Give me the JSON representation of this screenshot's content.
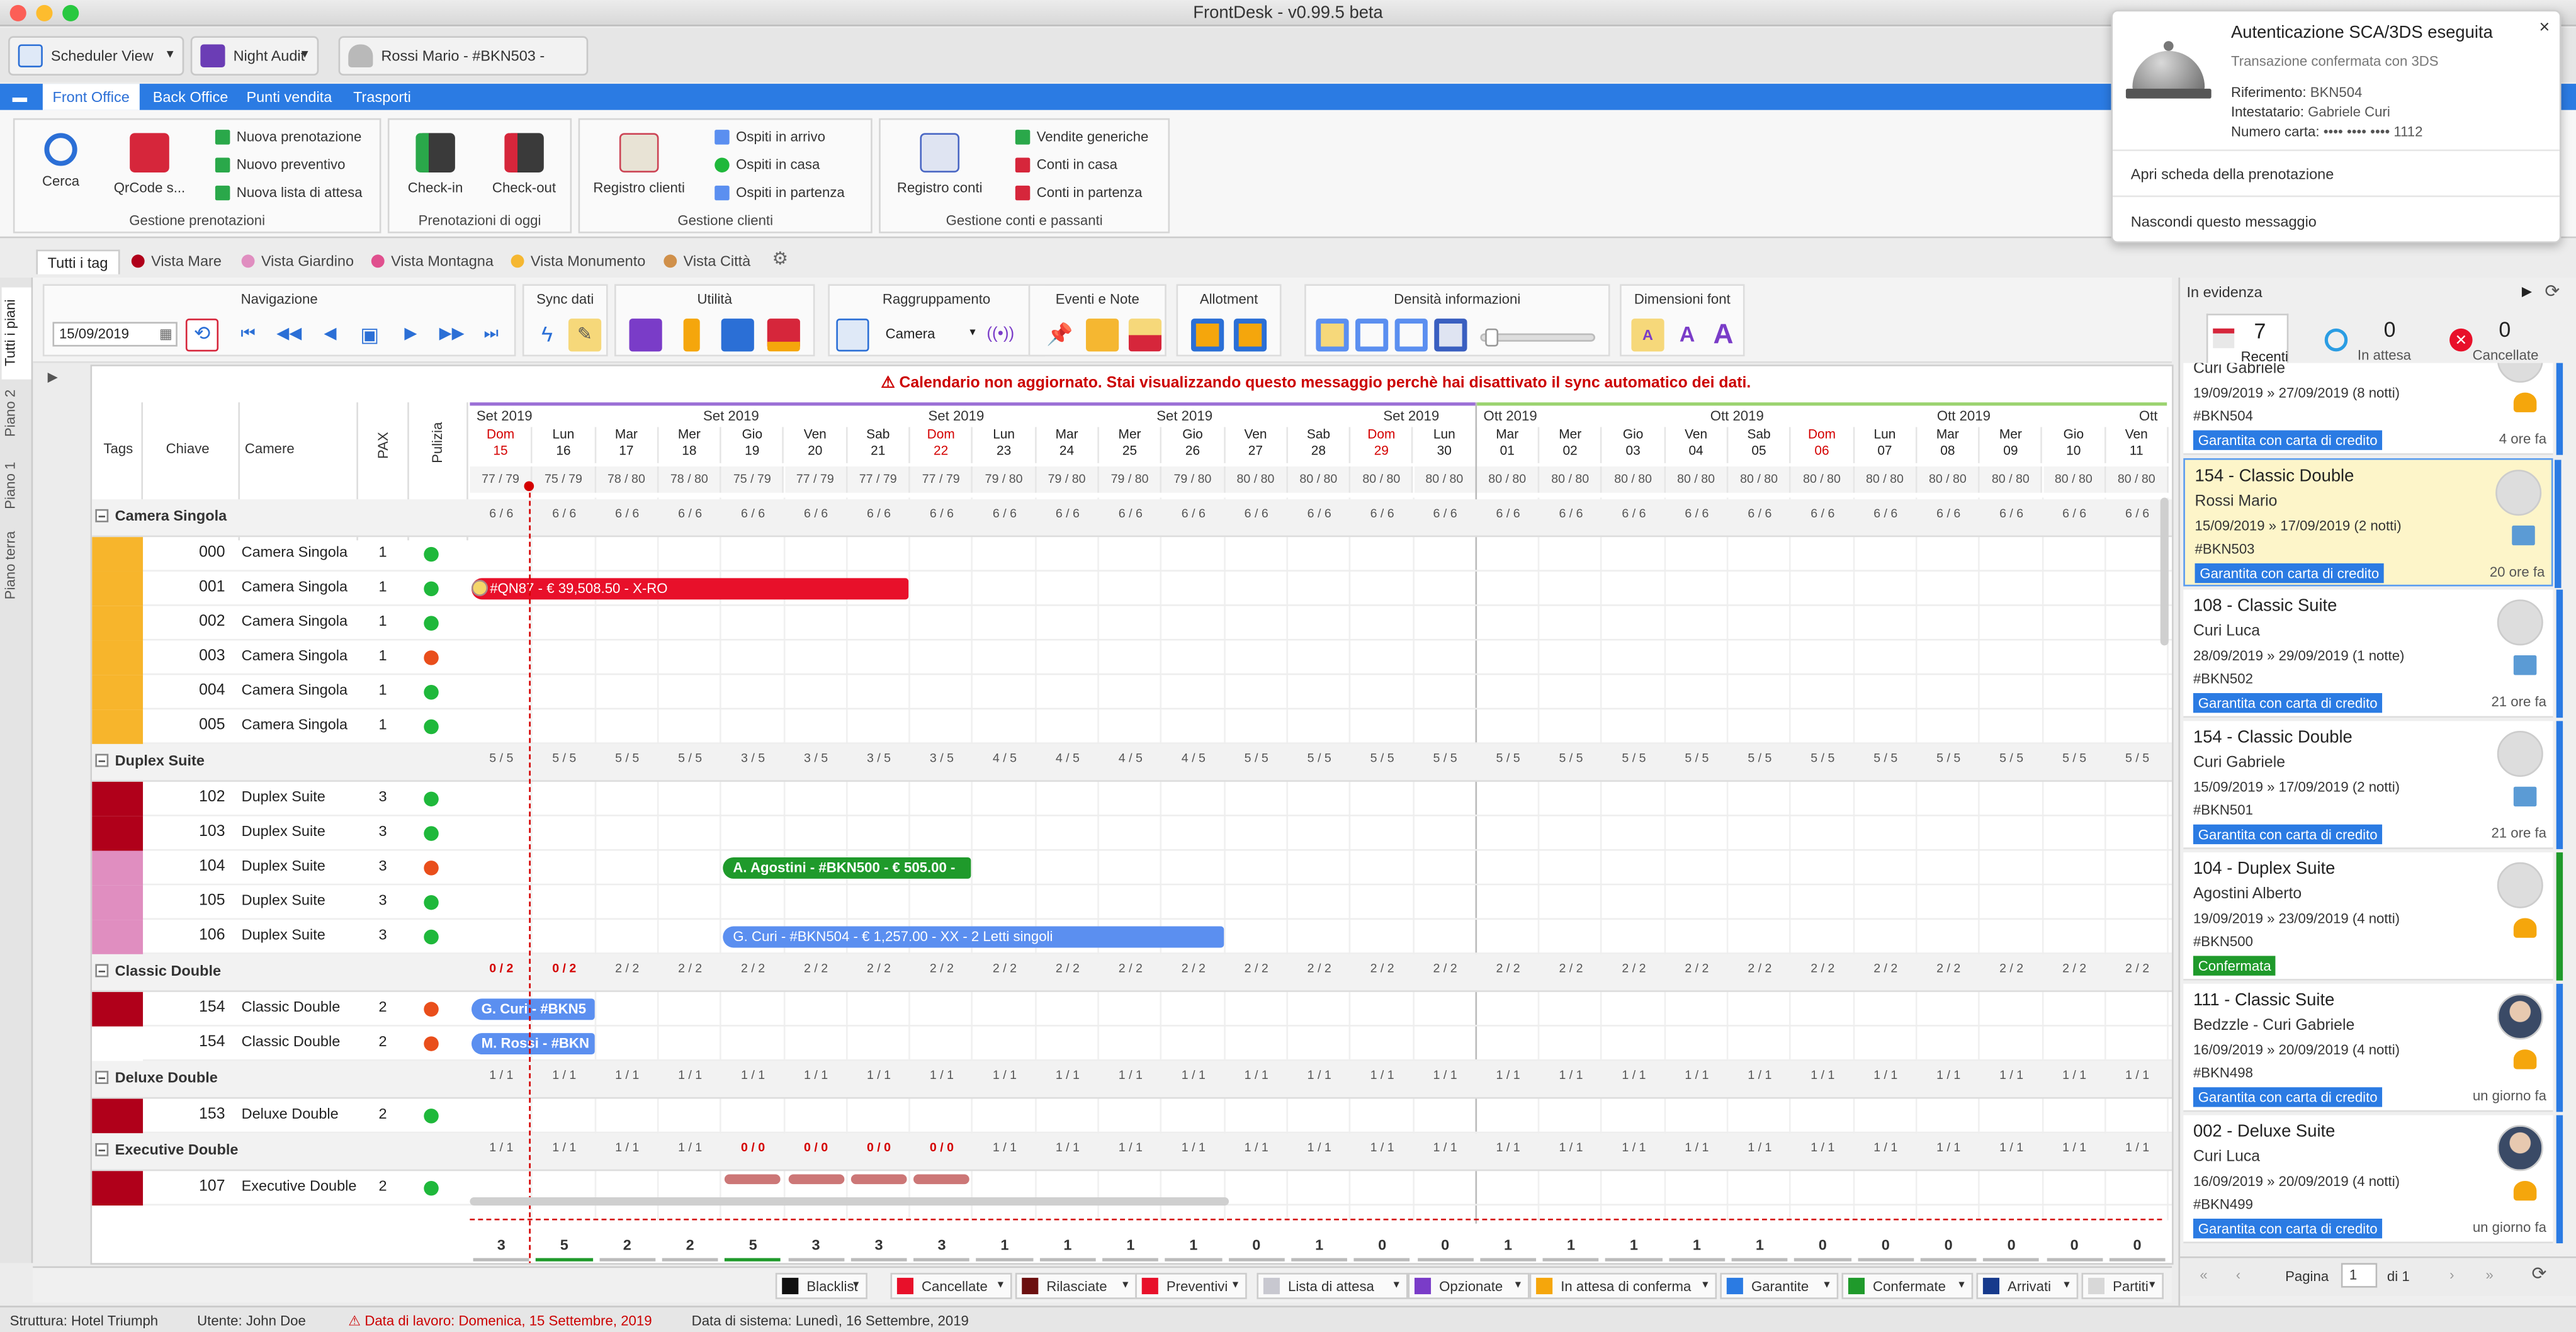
{
  "window": {
    "title": "FrontDesk - v0.99.5 beta"
  },
  "wintabs": [
    {
      "label": "Scheduler View"
    },
    {
      "label": "Night Audit"
    },
    {
      "label": "Rossi Mario - #BKN503 - Gara..."
    }
  ],
  "ribbon_tabs": [
    "Front Office",
    "Back Office",
    "Punti vendita",
    "Trasporti"
  ],
  "ribbon": {
    "gestione_prenotazioni": {
      "label": "Gestione prenotazioni",
      "cerca": "Cerca",
      "qrcode": "QrCode s...",
      "nuova_prenotazione": "Nuova prenotazione",
      "nuovo_preventivo": "Nuovo preventivo",
      "nuova_lista": "Nuova lista di attesa"
    },
    "prenotazioni_oggi": {
      "label": "Prenotazioni di oggi",
      "checkin": "Check-in",
      "checkout": "Check-out"
    },
    "gestione_clienti": {
      "label": "Gestione clienti",
      "registro": "Registro clienti",
      "arrivo": "Ospiti in arrivo",
      "casa": "Ospiti in casa",
      "partenza": "Ospiti in partenza"
    },
    "gestione_conti": {
      "label": "Gestione conti e passanti",
      "registro": "Registro conti",
      "vendite": "Vendite generiche",
      "conti_casa": "Conti in casa",
      "conti_partenza": "Conti in partenza"
    }
  },
  "tag_tabs": [
    {
      "label": "Tutti i tag",
      "color": ""
    },
    {
      "label": "Vista Mare",
      "color": "#b0001a"
    },
    {
      "label": "Vista Giardino",
      "color": "#e08ec0"
    },
    {
      "label": "Vista Montagna",
      "color": "#e0508e"
    },
    {
      "label": "Vista Monumento",
      "color": "#f5b731"
    },
    {
      "label": "Vista Città",
      "color": "#d0904a"
    }
  ],
  "side_tabs": [
    "Tutti i piani",
    "Piano 2",
    "Piano 1",
    "Piano terra"
  ],
  "toolbar": {
    "navigazione": "Navigazione",
    "date": "15/09/2019",
    "sync": "Sync dati",
    "utilita": "Utilità",
    "raggruppamento": "Raggruppamento",
    "raggruppamento_value": "Camera",
    "eventi": "Eventi e Note",
    "allotment": "Allotment",
    "densita": "Densità informazioni",
    "font": "Dimensioni font",
    "font_a": "A"
  },
  "grid": {
    "warning": "Calendario non aggiornato. Stai visualizzando questo messaggio perchè hai disattivato il sync automatico dei dati.",
    "headers": {
      "tags": "Tags",
      "chiave": "Chiave",
      "camere": "Camere",
      "pax": "PAX",
      "pulizia": "Pulizia"
    },
    "months": [
      {
        "label": "Set 2019"
      },
      {
        "label": "Set 2019"
      },
      {
        "label": "Set 2019"
      },
      {
        "label": "Set 2019"
      },
      {
        "label": "Set 2019"
      },
      {
        "label": "Ott 2019"
      },
      {
        "label": "Ott 2019"
      },
      {
        "label": "Ott 2019"
      },
      {
        "label": "Ott"
      }
    ],
    "days": [
      {
        "dow": "Dom",
        "d": "15",
        "red": true,
        "occ": "77 / 79"
      },
      {
        "dow": "Lun",
        "d": "16",
        "red": false,
        "occ": "75 / 79"
      },
      {
        "dow": "Mar",
        "d": "17",
        "red": false,
        "occ": "78 / 80"
      },
      {
        "dow": "Mer",
        "d": "18",
        "red": false,
        "occ": "78 / 80"
      },
      {
        "dow": "Gio",
        "d": "19",
        "red": false,
        "occ": "75 / 79"
      },
      {
        "dow": "Ven",
        "d": "20",
        "red": false,
        "occ": "77 / 79"
      },
      {
        "dow": "Sab",
        "d": "21",
        "red": false,
        "occ": "77 / 79"
      },
      {
        "dow": "Dom",
        "d": "22",
        "red": true,
        "occ": "77 / 79"
      },
      {
        "dow": "Lun",
        "d": "23",
        "red": false,
        "occ": "79 / 80"
      },
      {
        "dow": "Mar",
        "d": "24",
        "red": false,
        "occ": "79 / 80"
      },
      {
        "dow": "Mer",
        "d": "25",
        "red": false,
        "occ": "79 / 80"
      },
      {
        "dow": "Gio",
        "d": "26",
        "red": false,
        "occ": "79 / 80"
      },
      {
        "dow": "Ven",
        "d": "27",
        "red": false,
        "occ": "80 / 80"
      },
      {
        "dow": "Sab",
        "d": "28",
        "red": false,
        "occ": "80 / 80"
      },
      {
        "dow": "Dom",
        "d": "29",
        "red": true,
        "occ": "80 / 80"
      },
      {
        "dow": "Lun",
        "d": "30",
        "red": false,
        "occ": "80 / 80"
      },
      {
        "dow": "Mar",
        "d": "01",
        "red": false,
        "occ": "80 / 80"
      },
      {
        "dow": "Mer",
        "d": "02",
        "red": false,
        "occ": "80 / 80"
      },
      {
        "dow": "Gio",
        "d": "03",
        "red": false,
        "occ": "80 / 80"
      },
      {
        "dow": "Ven",
        "d": "04",
        "red": false,
        "occ": "80 / 80"
      },
      {
        "dow": "Sab",
        "d": "05",
        "red": false,
        "occ": "80 / 80"
      },
      {
        "dow": "Dom",
        "d": "06",
        "red": true,
        "occ": "80 / 80"
      },
      {
        "dow": "Lun",
        "d": "07",
        "red": false,
        "occ": "80 / 80"
      },
      {
        "dow": "Mar",
        "d": "08",
        "red": false,
        "occ": "80 / 80"
      },
      {
        "dow": "Mer",
        "d": "09",
        "red": false,
        "occ": "80 / 80"
      },
      {
        "dow": "Gio",
        "d": "10",
        "red": false,
        "occ": "80 / 80"
      },
      {
        "dow": "Ven",
        "d": "11",
        "red": false,
        "occ": "80 / 80"
      }
    ],
    "groups": [
      {
        "name": "Camera Singola",
        "occ": [
          "6 / 6",
          "6 / 6",
          "6 / 6",
          "6 / 6",
          "6 / 6",
          "6 / 6",
          "6 / 6",
          "6 / 6",
          "6 / 6",
          "6 / 6",
          "6 / 6",
          "6 / 6",
          "6 / 6",
          "6 / 6",
          "6 / 6",
          "6 / 6",
          "6 / 6",
          "6 / 6",
          "6 / 6",
          "6 / 6",
          "6 / 6",
          "6 / 6",
          "6 / 6",
          "6 / 6",
          "6 / 6",
          "6 / 6",
          "6 / 6"
        ],
        "rooms": [
          {
            "key": "000",
            "room": "Camera Singola",
            "pax": "1",
            "tag": "#f7b52c",
            "clean": "#1fb83b"
          },
          {
            "key": "001",
            "room": "Camera Singola",
            "pax": "1",
            "tag": "#f7b52c",
            "clean": "#1fb83b"
          },
          {
            "key": "002",
            "room": "Camera Singola",
            "pax": "1",
            "tag": "#f7b52c",
            "clean": "#1fb83b"
          },
          {
            "key": "003",
            "room": "Camera Singola",
            "pax": "1",
            "tag": "#f7b52c",
            "clean": "#e94e1b"
          },
          {
            "key": "004",
            "room": "Camera Singola",
            "pax": "1",
            "tag": "#f7b52c",
            "clean": "#1fb83b"
          },
          {
            "key": "005",
            "room": "Camera Singola",
            "pax": "1",
            "tag": "#f7b52c",
            "clean": "#1fb83b"
          }
        ]
      },
      {
        "name": "Duplex Suite",
        "occ": [
          "5 / 5",
          "5 / 5",
          "5 / 5",
          "5 / 5",
          "3 / 5",
          "3 / 5",
          "3 / 5",
          "3 / 5",
          "4 / 5",
          "4 / 5",
          "4 / 5",
          "4 / 5",
          "5 / 5",
          "5 / 5",
          "5 / 5",
          "5 / 5",
          "5 / 5",
          "5 / 5",
          "5 / 5",
          "5 / 5",
          "5 / 5",
          "5 / 5",
          "5 / 5",
          "5 / 5",
          "5 / 5",
          "5 / 5",
          "5 / 5"
        ],
        "rooms": [
          {
            "key": "102",
            "room": "Duplex Suite",
            "pax": "3",
            "tag": "#b0001a",
            "clean": "#1fb83b"
          },
          {
            "key": "103",
            "room": "Duplex Suite",
            "pax": "3",
            "tag": "#b0001a",
            "clean": "#1fb83b"
          },
          {
            "key": "104",
            "room": "Duplex Suite",
            "pax": "3",
            "tag": "#e08ec0",
            "clean": "#e94e1b"
          },
          {
            "key": "105",
            "room": "Duplex Suite",
            "pax": "3",
            "tag": "#e08ec0",
            "clean": "#1fb83b"
          },
          {
            "key": "106",
            "room": "Duplex Suite",
            "pax": "3",
            "tag": "#e08ec0",
            "clean": "#1fb83b"
          }
        ]
      },
      {
        "name": "Classic Double",
        "occ": [
          "0 / 2",
          "0 / 2",
          "2 / 2",
          "2 / 2",
          "2 / 2",
          "2 / 2",
          "2 / 2",
          "2 / 2",
          "2 / 2",
          "2 / 2",
          "2 / 2",
          "2 / 2",
          "2 / 2",
          "2 / 2",
          "2 / 2",
          "2 / 2",
          "2 / 2",
          "2 / 2",
          "2 / 2",
          "2 / 2",
          "2 / 2",
          "2 / 2",
          "2 / 2",
          "2 / 2",
          "2 / 2",
          "2 / 2",
          "2 / 2"
        ],
        "rooms": [
          {
            "key": "154",
            "room": "Classic Double",
            "pax": "2",
            "tag": "#b0001a",
            "clean": "#e94e1b"
          },
          {
            "key": "154",
            "room": "Classic Double",
            "pax": "2",
            "tag": "",
            "clean": "#e94e1b"
          }
        ]
      },
      {
        "name": "Deluxe Double",
        "occ": [
          "1 / 1",
          "1 / 1",
          "1 / 1",
          "1 / 1",
          "1 / 1",
          "1 / 1",
          "1 / 1",
          "1 / 1",
          "1 / 1",
          "1 / 1",
          "1 / 1",
          "1 / 1",
          "1 / 1",
          "1 / 1",
          "1 / 1",
          "1 / 1",
          "1 / 1",
          "1 / 1",
          "1 / 1",
          "1 / 1",
          "1 / 1",
          "1 / 1",
          "1 / 1",
          "1 / 1",
          "1 / 1",
          "1 / 1",
          "1 / 1"
        ],
        "rooms": [
          {
            "key": "153",
            "room": "Deluxe Double",
            "pax": "2",
            "tag": "#b0001a",
            "clean": "#1fb83b"
          }
        ]
      },
      {
        "name": "Executive Double",
        "occ": [
          "1 / 1",
          "1 / 1",
          "1 / 1",
          "1 / 1",
          "0 / 0",
          "0 / 0",
          "0 / 0",
          "0 / 0",
          "1 / 1",
          "1 / 1",
          "1 / 1",
          "1 / 1",
          "1 / 1",
          "1 / 1",
          "1 / 1",
          "1 / 1",
          "1 / 1",
          "1 / 1",
          "1 / 1",
          "1 / 1",
          "1 / 1",
          "1 / 1",
          "1 / 1",
          "1 / 1",
          "1 / 1",
          "1 / 1",
          "1 / 1"
        ],
        "rooms": [
          {
            "key": "107",
            "room": "Executive Double",
            "pax": "2",
            "tag": "#b0001a",
            "clean": "#1fb83b"
          }
        ]
      }
    ],
    "bookings": [
      {
        "text": "- #QN87 - € 39,508.50 - X-RO",
        "color": "#e8102a"
      },
      {
        "text": "A. Agostini - #BKN500 - € 505.00 -",
        "color": "#1f9a2b"
      },
      {
        "text": "G. Curi - #BKN504 - € 1,257.00 - XX - 2 Letti singoli",
        "color": "#5b8ff0"
      },
      {
        "text": "G. Curi - #BKN5",
        "color": "#5b8ff0"
      },
      {
        "text": "M. Rossi - #BKN",
        "color": "#5b8ff0"
      }
    ],
    "totals": [
      "3",
      "5",
      "2",
      "2",
      "5",
      "3",
      "3",
      "3",
      "1",
      "1",
      "1",
      "1",
      "0",
      "1",
      "0",
      "0",
      "1",
      "1",
      "1",
      "1",
      "1",
      "0",
      "0",
      "0",
      "0",
      "0",
      "0"
    ]
  },
  "legend": [
    {
      "label": "Blacklist",
      "color": "#111111"
    },
    {
      "label": "Cancellate",
      "color": "#e8102a"
    },
    {
      "label": "Rilasciate",
      "color": "#6b0f0f"
    },
    {
      "label": "Preventivi",
      "color": "#e8102a"
    },
    {
      "label": "Lista di attesa",
      "color": "#c8c8d0"
    },
    {
      "label": "Opzionate",
      "color": "#7a3cc8"
    },
    {
      "label": "In attesa di conferma",
      "color": "#f5a60c"
    },
    {
      "label": "Garantite",
      "color": "#2b7be3"
    },
    {
      "label": "Confermate",
      "color": "#1f9a2b"
    },
    {
      "label": "Arrivati",
      "color": "#173a8c"
    },
    {
      "label": "Partiti",
      "color": "#d8d8d8"
    }
  ],
  "status": {
    "struttura": "Struttura: Hotel Triumph",
    "utente": "Utente: John Doe",
    "data_lavoro": "Data di lavoro: Domenica, 15 Settembre, 2019",
    "data_sistema": "Data di sistema: Lunedì, 16 Settembre, 2019"
  },
  "panel": {
    "title": "In evidenza",
    "tabs": [
      {
        "count": "7",
        "label": "Recenti"
      },
      {
        "count": "0",
        "label": "In attesa"
      },
      {
        "count": "0",
        "label": "Cancellate"
      }
    ],
    "cards": [
      {
        "title": "",
        "name": "Curi Gabriele",
        "dates": "19/09/2019 » 27/09/2019 (8 notti)",
        "code": "#BKN504",
        "badge": "Garantita con carta di credito",
        "ago": "4 ore fa",
        "badge_color": "blue",
        "stripe": "#2b7be3"
      },
      {
        "title": "154 - Classic Double",
        "name": "Rossi Mario",
        "dates": "15/09/2019 » 17/09/2019 (2 notti)",
        "code": "#BKN503",
        "badge": "Garantita con carta di credito",
        "ago": "20 ore fa",
        "badge_color": "blue",
        "stripe": "#2b7be3"
      },
      {
        "title": "108 - Classic Suite",
        "name": "Curi Luca",
        "dates": "28/09/2019 » 29/09/2019 (1 notte)",
        "code": "#BKN502",
        "badge": "Garantita con carta di credito",
        "ago": "21 ore fa",
        "badge_color": "blue",
        "stripe": "#2b7be3"
      },
      {
        "title": "154 - Classic Double",
        "name": "Curi Gabriele",
        "dates": "15/09/2019 » 17/09/2019 (2 notti)",
        "code": "#BKN501",
        "badge": "Garantita con carta di credito",
        "ago": "21 ore fa",
        "badge_color": "blue",
        "stripe": "#2b7be3"
      },
      {
        "title": "104 - Duplex Suite",
        "name": "Agostini Alberto",
        "dates": "19/09/2019 » 23/09/2019 (4 notti)",
        "code": "#BKN500",
        "badge": "Confermata",
        "ago": "",
        "badge_color": "green",
        "stripe": "#1f9a2b"
      },
      {
        "title": "111 - Classic Suite",
        "name": "Bedzzle - Curi Gabriele",
        "dates": "16/09/2019 » 20/09/2019 (4 notti)",
        "code": "#BKN498",
        "badge": "Garantita con carta di credito",
        "ago": "un giorno fa",
        "badge_color": "blue",
        "stripe": "#2b7be3"
      },
      {
        "title": "002 - Deluxe Suite",
        "name": "Curi Luca",
        "dates": "16/09/2019 » 20/09/2019 (4 notti)",
        "code": "#BKN499",
        "badge": "Garantita con carta di credito",
        "ago": "un giorno fa",
        "badge_color": "blue",
        "stripe": "#2b7be3"
      }
    ],
    "pager": {
      "label": "Pagina",
      "value": "1",
      "of": "di 1"
    }
  },
  "notification": {
    "title": "Autenticazione SCA/3DS eseguita",
    "subtitle": "Transazione confermata con 3DS",
    "riferimento_label": "Riferimento:",
    "riferimento": "BKN504",
    "intestatario_label": "Intestatario:",
    "intestatario": "Gabriele Curi",
    "carta_label": "Numero carta:",
    "carta": "•••• •••• •••• 1112",
    "action1": "Apri scheda della prenotazione",
    "action2": "Nascondi questo messaggio",
    "close": "×"
  }
}
